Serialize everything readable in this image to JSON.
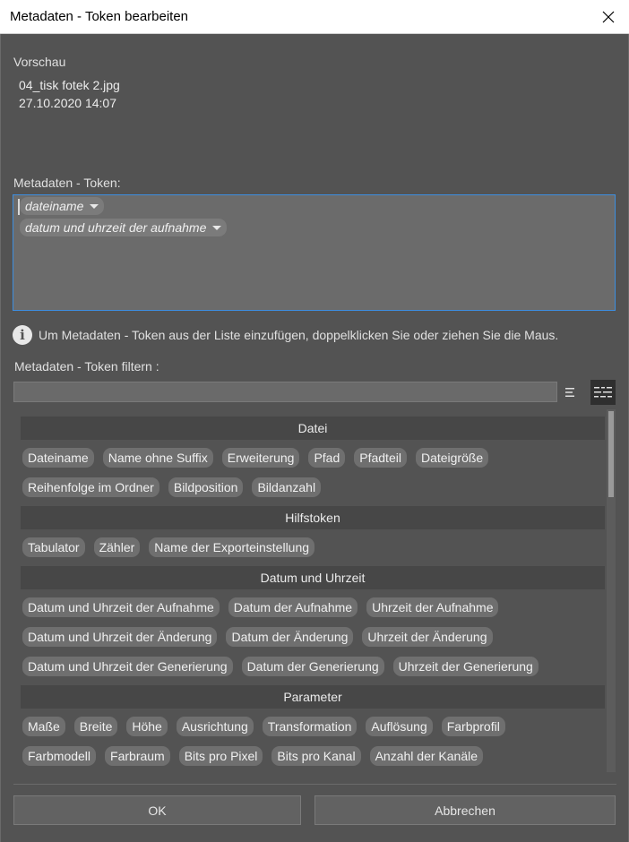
{
  "window": {
    "title": "Metadaten - Token bearbeiten"
  },
  "preview": {
    "label": "Vorschau",
    "line1": "04_tisk fotek 2.jpg",
    "line2": "27.10.2020 14:07"
  },
  "token_editor": {
    "label": "Metadaten - Token:",
    "tokens": [
      "dateiname",
      "datum und uhrzeit der aufnahme"
    ]
  },
  "info": {
    "icon": "info-icon",
    "text": "Um Metadaten - Token aus der Liste einzufügen, doppelklicken Sie oder ziehen Sie die Maus."
  },
  "filter": {
    "label": "Metadaten - Token filtern :",
    "value": "",
    "placeholder": ""
  },
  "sections": [
    {
      "title": "Datei",
      "rows": [
        [
          "Dateiname",
          "Name ohne Suffix",
          "Erweiterung",
          "Pfad",
          "Pfadteil",
          "Dateigröße"
        ],
        [
          "Reihenfolge im Ordner",
          "Bildposition",
          "Bildanzahl"
        ]
      ]
    },
    {
      "title": "Hilfstoken",
      "rows": [
        [
          "Tabulator",
          "Zähler",
          "Name der Exporteinstellung"
        ]
      ]
    },
    {
      "title": "Datum und Uhrzeit",
      "rows": [
        [
          "Datum und Uhrzeit der Aufnahme",
          "Datum der Aufnahme",
          "Uhrzeit der Aufnahme"
        ],
        [
          "Datum und Uhrzeit der Änderung",
          "Datum der Änderung",
          "Uhrzeit der Änderung"
        ],
        [
          "Datum und Uhrzeit der Generierung",
          "Datum der Generierung",
          "Uhrzeit der Generierung"
        ]
      ]
    },
    {
      "title": "Parameter",
      "rows": [
        [
          "Maße",
          "Breite",
          "Höhe",
          "Ausrichtung",
          "Transformation",
          "Auflösung",
          "Farbprofil"
        ],
        [
          "Farbmodell",
          "Farbraum",
          "Bits pro Pixel",
          "Bits pro Kanal",
          "Anzahl der Kanäle"
        ]
      ]
    }
  ],
  "buttons": {
    "ok": "OK",
    "cancel": "Abbrechen"
  }
}
